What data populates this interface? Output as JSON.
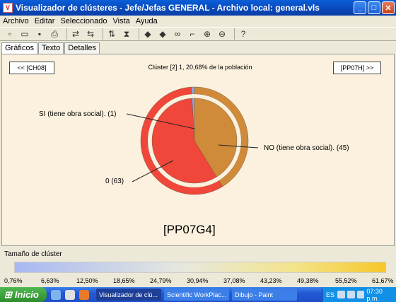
{
  "window": {
    "title": "Visualizador de clústeres - Jefe/Jefas GENERAL - Archivo local: general.vls"
  },
  "menu": [
    "Archivo",
    "Editar",
    "Seleccionado",
    "Vista",
    "Ayuda"
  ],
  "toolbar": [
    "new-icon",
    "open-icon",
    "save-icon",
    "print-icon",
    "sep",
    "swap-icon",
    "swap-back-icon",
    "sep",
    "sort-icon",
    "filter-icon",
    "sep",
    "arrow-left-icon",
    "arrow-right-icon",
    "binoculars-icon",
    "select-icon",
    "zoom-in-icon",
    "zoom-out-icon",
    "sep",
    "help-icon"
  ],
  "tabs": [
    "Gráficos",
    "Texto",
    "Detalles"
  ],
  "nav": {
    "prev": "<< [CH08]",
    "next": "[PP07H] >>"
  },
  "cluster_info": "Clúster [2] 1, 20,68% de la población",
  "pie": {
    "outer": [
      {
        "label": "SI (tiene obra social). (1)",
        "value": 1,
        "color": "#8ca4e8"
      },
      {
        "label": "NO (tiene obra social). (45)",
        "value": 45,
        "color": "#d08b3a"
      },
      {
        "label": "0 (63)",
        "value": 63,
        "color": "#f0473a"
      }
    ],
    "inner": [
      {
        "label": "SI (tiene obra social). (1)",
        "value": 1,
        "color": "#8ca4e8"
      },
      {
        "label": "NO (tiene obra social). (45)",
        "value": 45,
        "color": "#d08b3a"
      },
      {
        "label": "0 (63)",
        "value": 63,
        "color": "#f0473a"
      }
    ]
  },
  "labels": {
    "si": "SI (tiene obra social). (1)",
    "no": "NO (tiene obra social). (45)",
    "zero": "0 (63)"
  },
  "variable": "[PP07G4]",
  "size": {
    "label": "Tamaño de clúster",
    "ticks": [
      "0,76%",
      "6,63%",
      "12,50%",
      "18,65%",
      "24,79%",
      "30,94%",
      "37,08%",
      "43,23%",
      "49,38%",
      "55,52%",
      "61,67%"
    ]
  },
  "taskbar": {
    "start": "Inicio",
    "tasks": [
      "Visualizador de clú...",
      "Scientific WorkPlac...",
      "Dibujo - Paint"
    ],
    "lang": "ES",
    "time": "07:30 p.m."
  }
}
